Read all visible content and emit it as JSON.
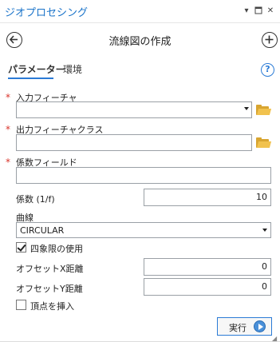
{
  "window": {
    "title": "ジオプロセシング",
    "controls": [
      "chevron-down-icon",
      "restore-icon",
      "close-icon"
    ]
  },
  "header": {
    "title": "流線図の作成",
    "back_icon": "arrow-left-circle-icon",
    "add_icon": "plus-circle-icon"
  },
  "tabs": [
    {
      "label": "パラメーター",
      "active": true
    },
    {
      "label": "環境",
      "active": false
    }
  ],
  "help_label": "?",
  "params": {
    "input_feature": {
      "label": "入力フィーチャ",
      "required": true,
      "value": ""
    },
    "output_feature_class": {
      "label": "出力フィーチャクラス",
      "required": true,
      "value": ""
    },
    "coefficient_field": {
      "label": "係数フィールド",
      "required": true,
      "value": ""
    },
    "coefficient": {
      "label": "係数 (1/f)",
      "value": "10"
    },
    "curve": {
      "label": "曲線",
      "value": "CIRCULAR"
    },
    "use_quadrants": {
      "label": "四象限の使用",
      "checked": true
    },
    "offset_x": {
      "label": "オフセットX距離",
      "value": "0"
    },
    "offset_y": {
      "label": "オフセットY距離",
      "value": "0"
    },
    "insert_vertex": {
      "label": "頂点を挿入",
      "checked": false
    }
  },
  "required_mark": "*",
  "run_button": {
    "label": "実行"
  },
  "colors": {
    "accent": "#2b7bd6",
    "title": "#1a73c9",
    "required": "#d9342b",
    "folder": "#f1c24e"
  }
}
